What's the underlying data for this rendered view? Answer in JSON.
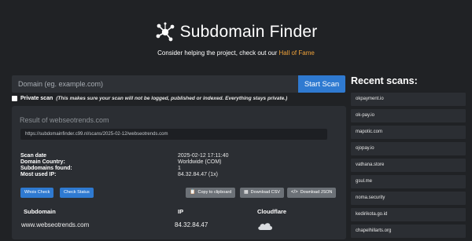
{
  "header": {
    "title": "Subdomain Finder",
    "tagline_prefix": "Consider helping the project, check out our ",
    "tagline_link": "Hall of Fame"
  },
  "search": {
    "placeholder": "Domain (eg. example.com)",
    "button_label": "Start Scan"
  },
  "private_scan": {
    "label": "Private scan",
    "note": "(This makes sure your scan will not be logged, published or indexed. Everything stays private.)"
  },
  "result": {
    "title": "Result of webseotrends.com",
    "url": "https://subdomainfinder.c99.nl/scans/2025-02-12/webseotrends.com",
    "info": [
      {
        "label": "Scan date",
        "value": "2025-02-12 17:11:40"
      },
      {
        "label": "Domain Country:",
        "value": "Worldwide (COM)"
      },
      {
        "label": "Subdomains found:",
        "value": "1"
      },
      {
        "label": "Most used IP:",
        "value": "84.32.84.47 (1x)"
      }
    ],
    "buttons": {
      "whois": "Whois Check",
      "status": "Check Status",
      "copy": "Copy to clipboard",
      "csv": "Download CSV",
      "json": "Download JSON"
    },
    "table": {
      "headers": [
        "Subdomain",
        "IP",
        "Cloudflare"
      ],
      "rows": [
        {
          "subdomain": "www.webseotrends.com",
          "ip": "84.32.84.47",
          "cloudflare_icon": "cloud-icon"
        }
      ]
    }
  },
  "recent": {
    "title": "Recent scans:",
    "items": [
      "okpayment.io",
      "ok-pay.io",
      "mapotic.com",
      "ojopay.io",
      "vathana.store",
      "gsul.me",
      "noma.security",
      "kedirikota.go.id",
      "chapelhillarts.org"
    ]
  },
  "colors": {
    "background": "#202225",
    "panel": "#2b2e33",
    "accent_blue": "#2f7ad1",
    "link_orange": "#f0a33a",
    "button_gray": "#6c7177"
  }
}
